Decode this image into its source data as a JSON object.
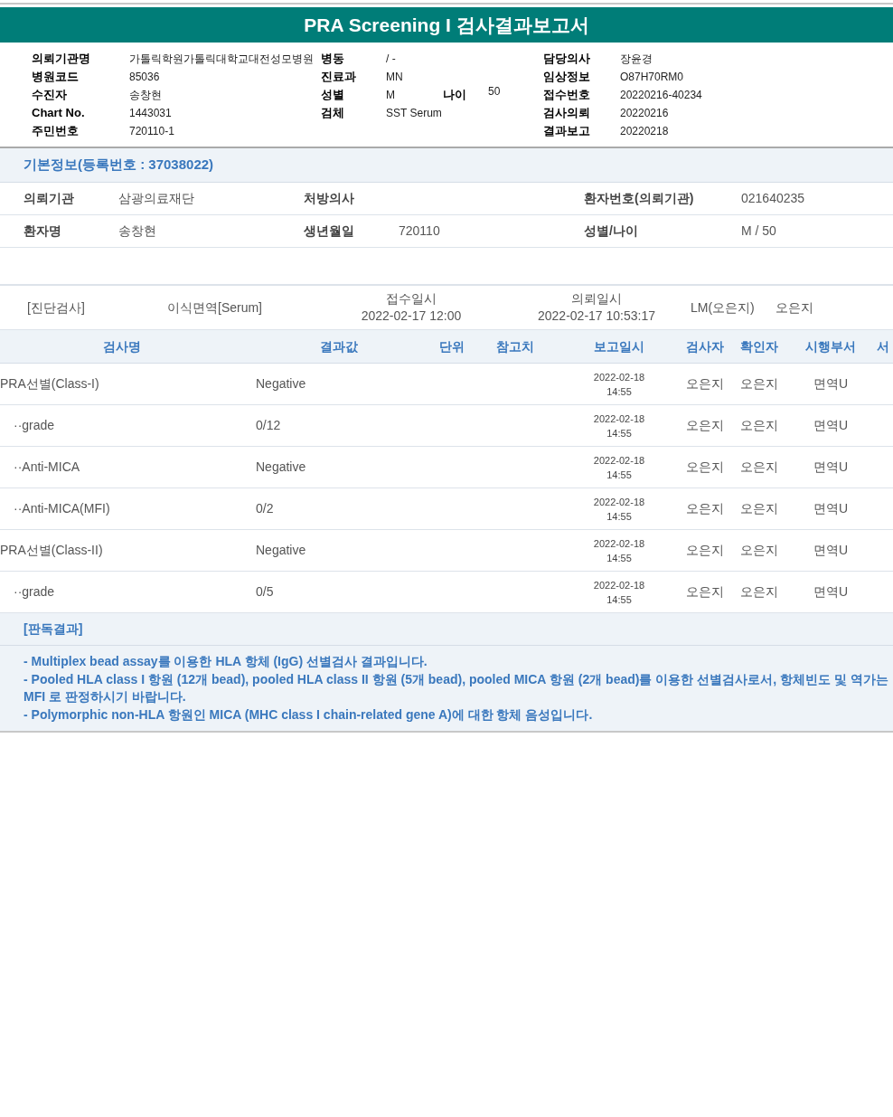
{
  "title": "PRA Screening I 검사결과보고서",
  "header": {
    "left": [
      {
        "label": "의뢰기관명",
        "value": "가톨릭학원가톨릭대학교대전성모병원"
      },
      {
        "label": "병원코드",
        "value": "85036"
      },
      {
        "label": "수진자",
        "value": "송창현"
      },
      {
        "label": "Chart No.",
        "value": "1443031"
      },
      {
        "label": "주민번호",
        "value": "720110-1"
      }
    ],
    "middle": [
      {
        "label": "병동",
        "value": "/ -"
      },
      {
        "label": "진료과",
        "value": "MN"
      },
      {
        "label": "성별",
        "value": "M",
        "extra": {
          "label": "나이",
          "value": "50"
        }
      },
      {
        "label": "검체",
        "value": "SST Serum"
      }
    ],
    "right": [
      {
        "label": "담당의사",
        "value": "장윤경"
      },
      {
        "label": "임상정보",
        "value": "O87H70RM0"
      },
      {
        "label": "접수번호",
        "value": "20220216-40234"
      },
      {
        "label": "검사의뢰",
        "value": "20220216"
      },
      {
        "label": "결과보고",
        "value": "20220218"
      }
    ]
  },
  "basic_info": {
    "title": "기본정보(등록번호 : 37038022)",
    "rows": [
      [
        {
          "label": "의뢰기관",
          "value": "삼광의료재단"
        },
        {
          "label": "처방의사"
        },
        {
          "label": "환자번호(의뢰기관)",
          "value": "021640235"
        }
      ],
      [
        {
          "label": "환자명",
          "value": "송창현"
        },
        {
          "label": "생년월일",
          "value": "720110"
        },
        {
          "label": "성별/나이",
          "value": "M / 50"
        }
      ]
    ]
  },
  "order": {
    "category": "[진단검사]",
    "specimen": "이식면역[Serum]",
    "received": {
      "label": "접수일시",
      "value": "2022-02-17  12:00"
    },
    "requested": {
      "label": "의뢰일시",
      "value": "2022-02-17  10:53:17"
    },
    "lab": "LM(오은지)",
    "person": "오은지"
  },
  "table": {
    "columns": [
      "검사명",
      "결과값",
      "단위",
      "참고치",
      "보고일시",
      "검사자",
      "확인자",
      "시행부서",
      "서"
    ],
    "rows": [
      {
        "name": "PRA선별(Class-I)",
        "result": "Negative",
        "date": "2022-02-18",
        "time": "14:55",
        "tester": "오은지",
        "confirmer": "오은지",
        "department": "면역U",
        "children": [
          {
            "name": "··grade",
            "result": "0/12",
            "date": "2022-02-18",
            "time": "14:55",
            "tester": "오은지",
            "confirmer": "오은지",
            "department": "면역U"
          },
          {
            "name": "··Anti-MICA",
            "result": "Negative",
            "date": "2022-02-18",
            "time": "14:55",
            "tester": "오은지",
            "confirmer": "오은지",
            "department": "면역U"
          },
          {
            "name": "··Anti-MICA(MFI)",
            "result": "0/2",
            "date": "2022-02-18",
            "time": "14:55",
            "tester": "오은지",
            "confirmer": "오은지",
            "department": "면역U"
          }
        ]
      },
      {
        "name": "PRA선별(Class-II)",
        "result": "Negative",
        "date": "2022-02-18",
        "time": "14:55",
        "tester": "오은지",
        "confirmer": "오은지",
        "department": "면역U",
        "children": [
          {
            "name": "··grade",
            "result": "0/5",
            "date": "2022-02-18",
            "time": "14:55",
            "tester": "오은지",
            "confirmer": "오은지",
            "department": "면역U"
          }
        ]
      }
    ]
  },
  "interpretation": {
    "title": "[판독결과]",
    "lines": [
      "- Multiplex bead assay를 이용한 HLA 항체 (IgG) 선별검사 결과입니다.",
      "- Pooled HLA class I 항원 (12개 bead), pooled HLA class II 항원 (5개 bead), pooled MICA 항원 (2개 bead)를 이용한 선별검사로서, 항체빈도 및 역가는 MFI 로 판정하시기 바랍니다.",
      "- Polymorphic non-HLA 항원인 MICA (MHC class I chain-related gene A)에 대한 항체 음성입니다."
    ]
  }
}
